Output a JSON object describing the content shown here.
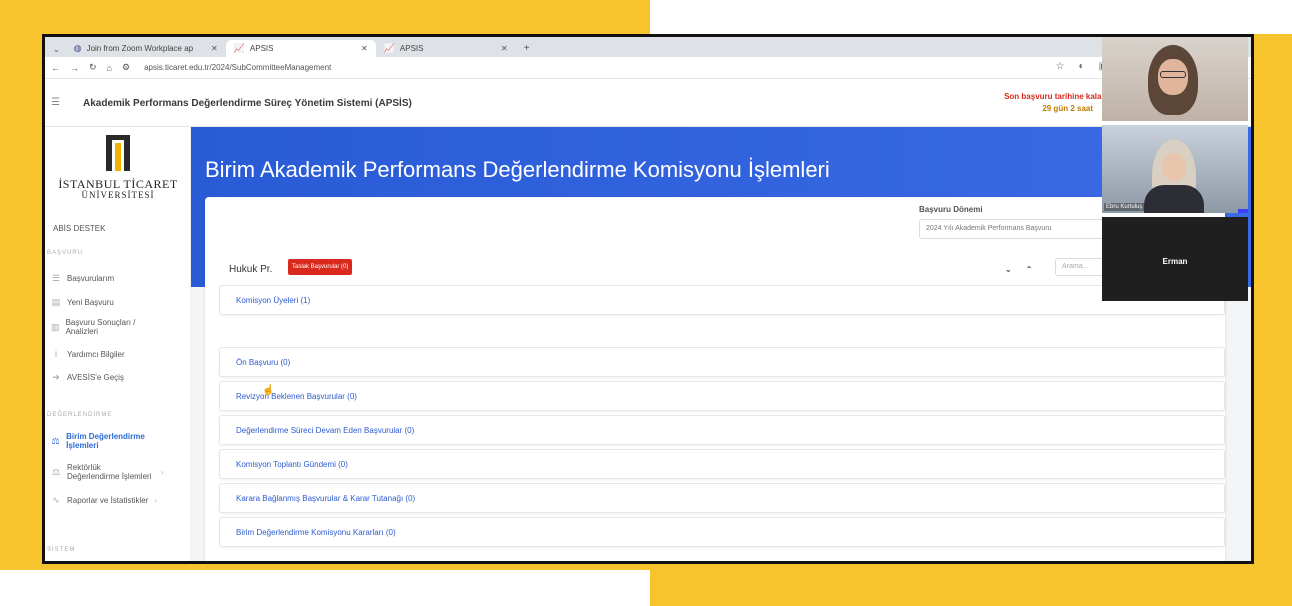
{
  "browser": {
    "tabs": [
      {
        "label": "Join from Zoom Workplace ap"
      },
      {
        "label": "APSIS"
      },
      {
        "label": "APSIS"
      }
    ],
    "tab_caret": "⌄",
    "new_tab": "+",
    "url": "apsis.ticaret.edu.tr/2024/SubCommitteeManagement"
  },
  "header": {
    "title": "Akademik Performans Değerlendirme Süreç Yönetim Sistemi (APSİS)",
    "deadline_line1": "Son başvuru tarihine kalan s",
    "deadline_line2": "29 gün 2 saat"
  },
  "sidebar": {
    "logo_line1": "İSTANBUL TİCARET",
    "logo_line2": "ÜNİVERSİTESİ",
    "support": "ABİS DESTEK",
    "section_basvuru": "BAŞVURU",
    "section_degerlendirme": "DEĞERLENDİRME",
    "section_sistem": "SİSTEM",
    "items": [
      {
        "label": "Başvurularım",
        "icon": "list-icon"
      },
      {
        "label": "Yeni Başvuru",
        "icon": "document-icon"
      },
      {
        "label": "Başvuru Sonuçları / Analizleri",
        "icon": "chart-doc-icon"
      },
      {
        "label": "Yardımcı Bilgiler",
        "icon": "info-icon"
      },
      {
        "label": "AVESİS'e Geçiş",
        "icon": "arrow-icon"
      },
      {
        "label": "Birim Değerlendirme İşlemleri",
        "icon": "scale-icon"
      },
      {
        "label": "Rektörlük Değerlendirme İşlemleri",
        "icon": "scale-icon"
      },
      {
        "label": "Raporlar ve İstatistikler",
        "icon": "pulse-icon"
      }
    ]
  },
  "main": {
    "page_title": "Birim Akademik Performans Değerlendirme Komisyonu İşlemleri",
    "period_label": "Başvuru Dönemi",
    "period_value": "2024 Yılı Akademik Performans Başvuru",
    "unit_name": "Hukuk Pr.",
    "draft_badge": "Taslak Başvurular (0)",
    "search_placeholder": "Arama...",
    "accordion": [
      "Komisyon Üyeleri (1)",
      "Ön Başvuru (0)",
      "Revizyon Beklenen Başvurular (0)",
      "Değerlendirme Süreci Devam Eden Başvurular (0)",
      "Komisyon Toplantı Gündemi (0)",
      "Karara Bağlanmış Başvurular & Karar Tutanağı (0)",
      "Birim Değerlendirme Komisyonu Kararları (0)"
    ]
  },
  "videos": {
    "participant2": "Ebru Kurtuluş",
    "participant3": "Erman"
  }
}
